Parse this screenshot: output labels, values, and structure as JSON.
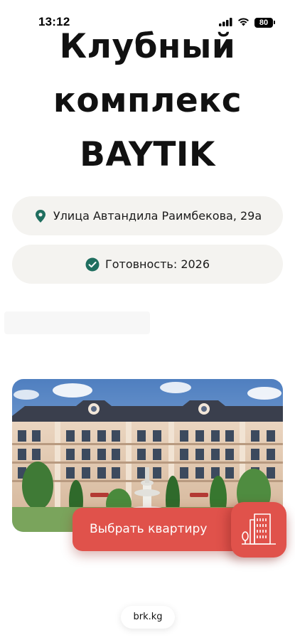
{
  "status_bar": {
    "time": "13:12",
    "battery": "80",
    "signal_icon": "cellular-signal-icon",
    "wifi_icon": "wifi-icon"
  },
  "title": {
    "line1": "Клубный",
    "line2": "комплекс",
    "line3": "BAYTIK"
  },
  "address": {
    "icon": "map-pin-icon",
    "text": "Улица Автандила Раимбекова, 29а"
  },
  "readiness": {
    "icon": "check-circle-icon",
    "text": "Готовность: 2026"
  },
  "colors": {
    "accent_green": "#1f6e5f",
    "cta_red": "#e0524b",
    "pill_bg": "#f4f3f0"
  },
  "cta": {
    "label": "Выбрать квартиру",
    "icon": "building-icon"
  },
  "footer": {
    "link": "brk.kg"
  }
}
